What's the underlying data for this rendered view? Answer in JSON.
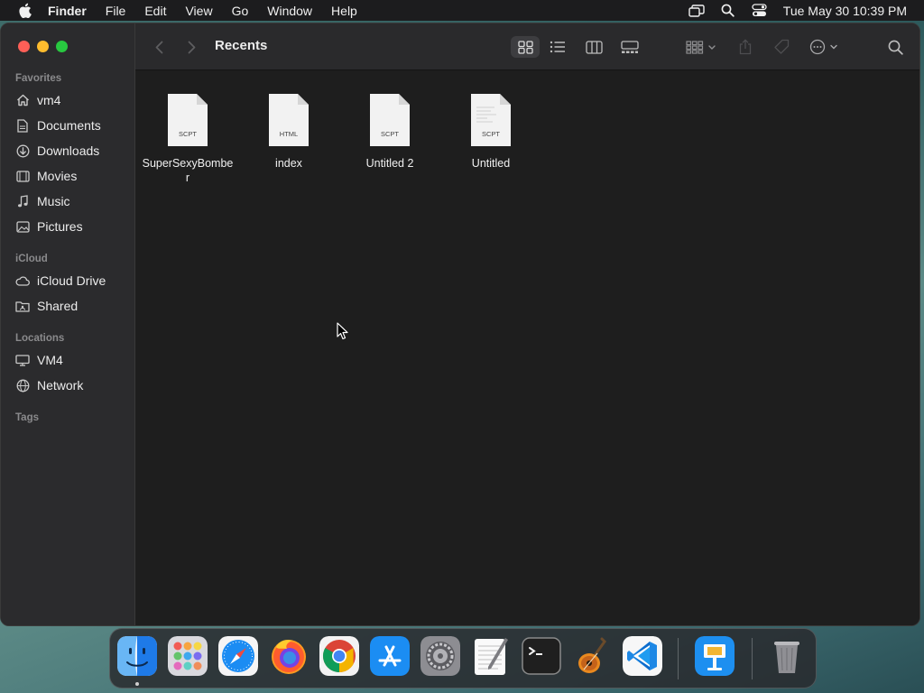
{
  "menubar": {
    "app_name": "Finder",
    "items": [
      "File",
      "Edit",
      "View",
      "Go",
      "Window",
      "Help"
    ],
    "clock": "Tue May 30  10:39 PM"
  },
  "window": {
    "title": "Recents"
  },
  "sidebar": {
    "sections": {
      "favorites": "Favorites",
      "icloud": "iCloud",
      "locations": "Locations",
      "tags": "Tags"
    },
    "favorites": [
      {
        "label": "vm4",
        "icon": "home-icon"
      },
      {
        "label": "Documents",
        "icon": "document-icon"
      },
      {
        "label": "Downloads",
        "icon": "download-icon"
      },
      {
        "label": "Movies",
        "icon": "film-icon"
      },
      {
        "label": "Music",
        "icon": "music-note-icon"
      },
      {
        "label": "Pictures",
        "icon": "photo-icon"
      }
    ],
    "icloud": [
      {
        "label": "iCloud Drive",
        "icon": "cloud-icon"
      },
      {
        "label": "Shared",
        "icon": "shared-folder-icon"
      }
    ],
    "locations": [
      {
        "label": "VM4",
        "icon": "display-icon"
      },
      {
        "label": "Network",
        "icon": "globe-icon"
      }
    ]
  },
  "files": [
    {
      "name": "SuperSexyBomber",
      "ext": "SCPT"
    },
    {
      "name": "index",
      "ext": "HTML"
    },
    {
      "name": "Untitled 2",
      "ext": "SCPT"
    },
    {
      "name": "Untitled",
      "ext": "SCPT"
    }
  ],
  "dock": {
    "apps": [
      "Finder",
      "Launchpad",
      "Safari",
      "Firefox",
      "Chrome",
      "App Store",
      "System Settings",
      "TextEdit",
      "Terminal",
      "GarageBand",
      "Visual Studio Code",
      "Keynote",
      "Trash"
    ]
  },
  "colors": {
    "menubar_bg": "#1c1c1e",
    "window_bg": "#1e1e1e",
    "sidebar_bg": "#2b2b2d",
    "close": "#ff5f57",
    "minimize": "#febc2e",
    "zoom": "#28c840"
  }
}
